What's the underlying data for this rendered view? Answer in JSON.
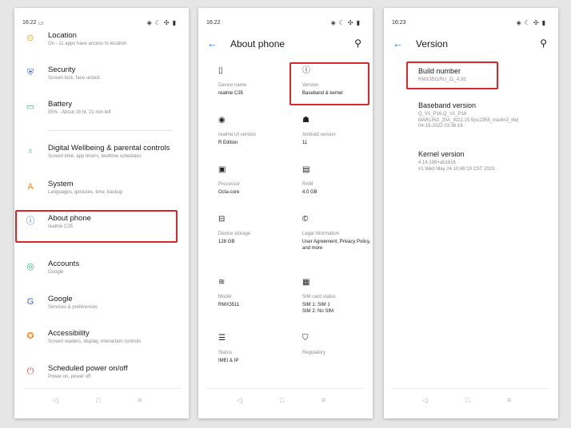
{
  "phone1": {
    "status_time": "16:22",
    "notif_icon": "message-icon",
    "items": [
      {
        "title": "Location",
        "subtitle": "On - 11 apps have access to location",
        "icon": "location-icon",
        "glyph": "⊙",
        "color": "#f0a225"
      },
      {
        "title": "Security",
        "subtitle": "Screen lock, face unlock",
        "icon": "shield-icon",
        "glyph": "⛨",
        "color": "#3b66d6"
      },
      {
        "title": "Battery",
        "subtitle": "95% - About 16 hr, 21 min left",
        "icon": "battery-icon",
        "glyph": "▭",
        "color": "#2bb673"
      },
      {
        "title": "Digital Wellbeing & parental controls",
        "subtitle": "Screen time, app timers, bedtime schedules",
        "icon": "wellbeing-icon",
        "glyph": "♁",
        "color": "#2bb673"
      },
      {
        "title": "System",
        "subtitle": "Languages, gestures, time, backup",
        "icon": "system-icon",
        "glyph": "A",
        "color": "#f08a24"
      },
      {
        "title": "About phone",
        "subtitle": "realme C35",
        "icon": "info-icon",
        "glyph": "ⓘ",
        "color": "#3b66d6"
      },
      {
        "title": "Accounts",
        "subtitle": "Google",
        "icon": "accounts-icon",
        "glyph": "◎",
        "color": "#2bb673"
      },
      {
        "title": "Google",
        "subtitle": "Services & preferences",
        "icon": "google-icon",
        "glyph": "G",
        "color": "#3b66d6"
      },
      {
        "title": "Accessibility",
        "subtitle": "Screen readers, display, interaction controls",
        "icon": "accessibility-icon",
        "glyph": "✪",
        "color": "#f08a24"
      },
      {
        "title": "Scheduled power on/off",
        "subtitle": "Power on, power off",
        "icon": "power-icon",
        "glyph": "⏻",
        "color": "#e5484d"
      }
    ]
  },
  "phone2": {
    "status_time": "16:22",
    "title": "About phone",
    "cells": [
      {
        "label": "Device name",
        "value": "realme C35",
        "icon": "phone-icon",
        "glyph": "▯"
      },
      {
        "label": "Version",
        "value": "Baseband & kernel",
        "icon": "info-icon",
        "glyph": "ⓘ"
      },
      {
        "label": "realme UI version",
        "value": "R Edition",
        "icon": "realme-ui-icon",
        "glyph": "◉"
      },
      {
        "label": "Android version",
        "value": "11",
        "icon": "android-icon",
        "glyph": "☗"
      },
      {
        "label": "Processor",
        "value": "Octa-core",
        "icon": "processor-icon",
        "glyph": "▣"
      },
      {
        "label": "RAM",
        "value": "4.0 GB",
        "icon": "ram-icon",
        "glyph": "▤"
      },
      {
        "label": "Device storage",
        "value": "128 GB",
        "icon": "storage-icon",
        "glyph": "⊟"
      },
      {
        "label": "Legal information",
        "value": "User Agreement, Privacy Policy, and more",
        "icon": "copyright-icon",
        "glyph": "©"
      },
      {
        "label": "Model",
        "value": "RMX3511",
        "icon": "layers-icon",
        "glyph": "≋"
      },
      {
        "label": "SIM card status",
        "value": "SIM 1: SIM 1\nSIM 2: No SIM",
        "icon": "sim-icon",
        "glyph": "▦"
      },
      {
        "label": "Status",
        "value": "IMEI & IP",
        "icon": "status-icon",
        "glyph": "☰"
      },
      {
        "label": "Regulatory",
        "value": "",
        "icon": "regulatory-icon",
        "glyph": "⛉"
      }
    ]
  },
  "phone3": {
    "status_time": "16:23",
    "title": "Version",
    "items": [
      {
        "title": "Build number",
        "value": "RMX3511RU_11_A.81"
      },
      {
        "title": "Baseband version",
        "value": "Q_V1_P16,Q_V1_P16\nMARLIN3_20A_W22.15.5|sc2355_marlin3_lite|\n04-15-2022 03:36:16"
      },
      {
        "title": "Kernel version",
        "value": "4.14.199+ab1816\n#1 Wed May 24 10:48:19 CST 2023"
      }
    ]
  },
  "nav": {
    "back": "◁",
    "home": "□",
    "recents": "≡"
  },
  "colors": {
    "accent": "#1c6fd8",
    "highlight": "#d8262b"
  }
}
